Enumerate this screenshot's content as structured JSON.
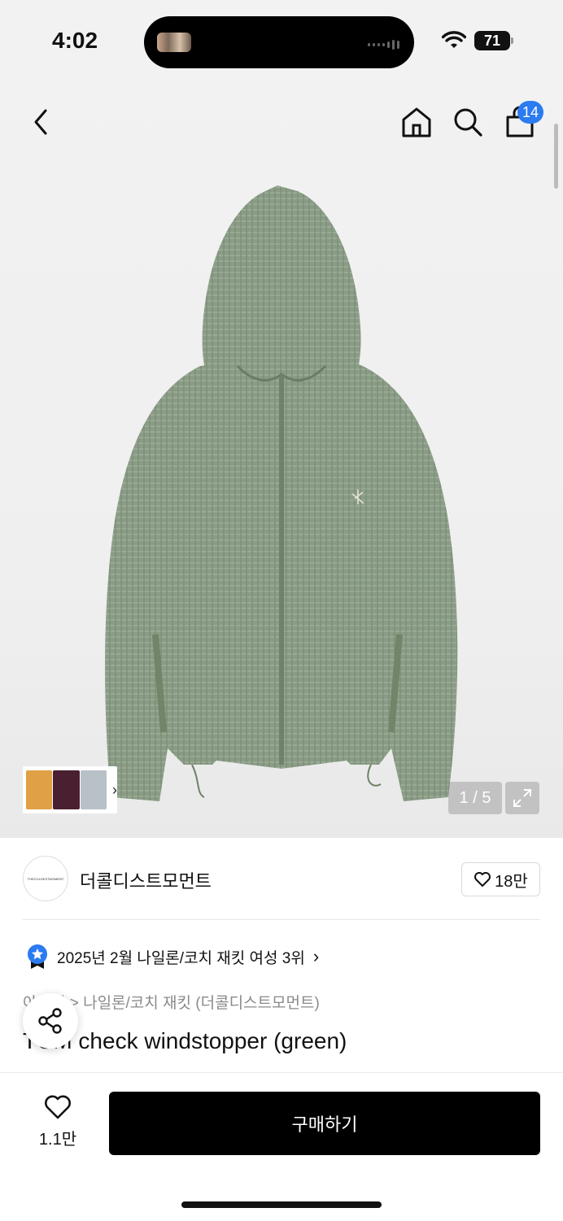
{
  "status_bar": {
    "time": "4:02",
    "battery": "71"
  },
  "header": {
    "cart_count": "14"
  },
  "gallery": {
    "counter": "1 / 5"
  },
  "brand": {
    "name": "더콜디스트모먼트",
    "logo_text": "THECOLDESTMOMENT",
    "like_count": "18만"
  },
  "ranking": {
    "text": "2025년 2월 나일론/코치 재킷 여성 3위"
  },
  "breadcrumb": {
    "text": "아우터 > 나일론/코치 재킷 (더콜디스트모먼트)"
  },
  "product": {
    "title": "TCM check windstopper (green)"
  },
  "bottom": {
    "wish_count": "1.1만",
    "buy_label": "구매하기"
  },
  "colors": {
    "accent": "#2b7bf1",
    "jacket": "#8a9c86",
    "buy_button": "#000000"
  }
}
